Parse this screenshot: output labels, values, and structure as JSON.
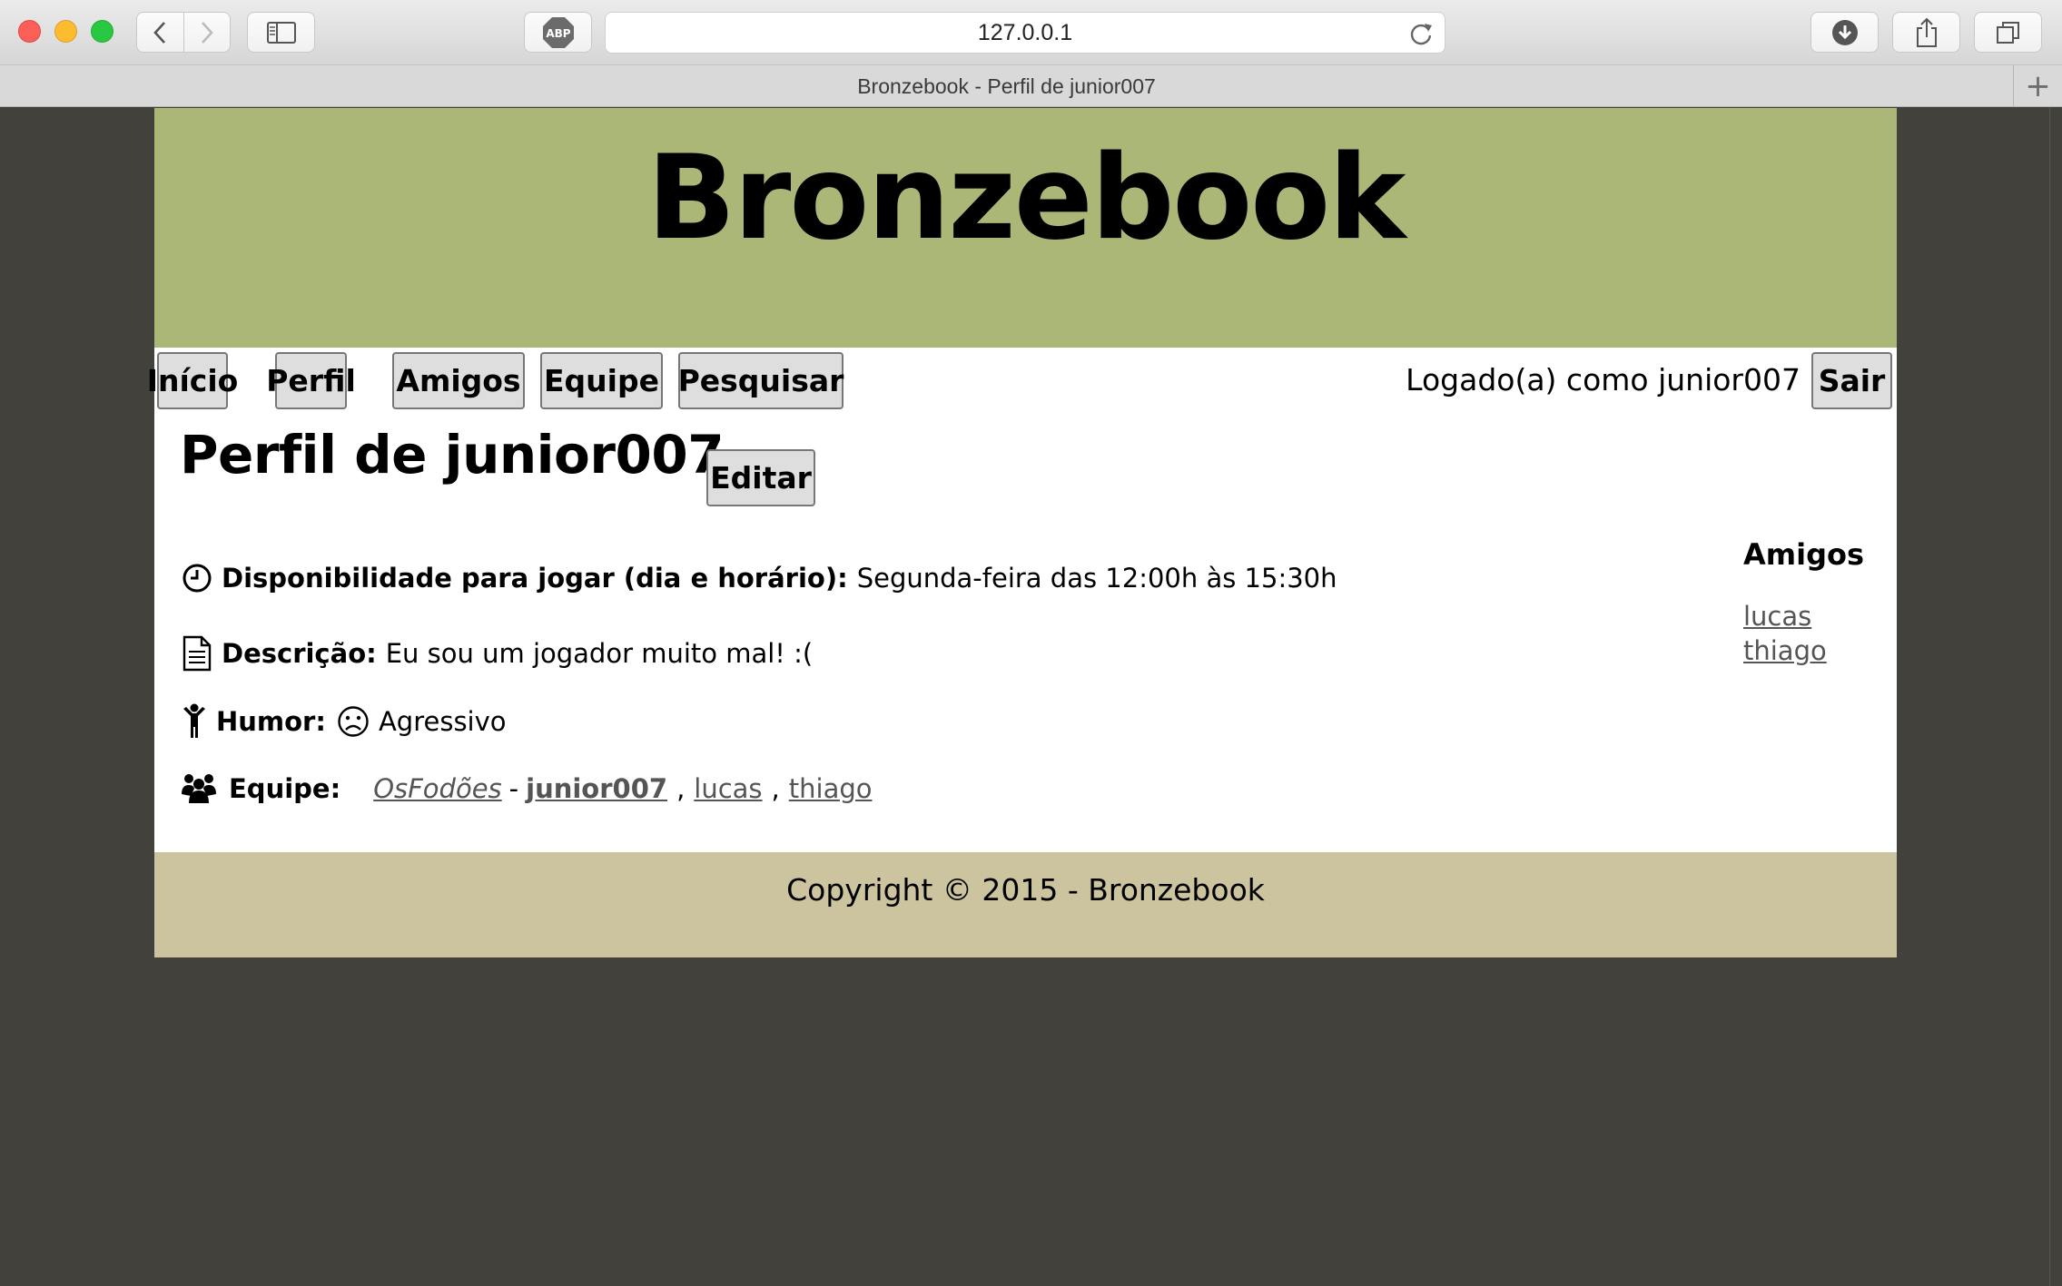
{
  "browser": {
    "url": "127.0.0.1",
    "tab_title": "Bronzebook - Perfil de junior007",
    "adblock_label": "ABP",
    "new_tab_label": "+"
  },
  "site": {
    "title": "Bronzebook"
  },
  "menu": {
    "items": [
      "Início",
      "Perfil",
      "Amigos",
      "Equipe",
      "Pesquisar"
    ],
    "logged_text": "Logado(a) como junior007",
    "logout_label": "Sair"
  },
  "profile": {
    "title": "Perfil de junior007",
    "edit_label": "Editar",
    "availability_label": "Disponibilidade para jogar (dia e horário):",
    "availability_value": "Segunda-feira das 12:00h às 15:30h",
    "description_label": "Descrição:",
    "description_value": "Eu sou um jogador muito mal! :(",
    "mood_label": "Humor:",
    "mood_icon": "frown-face-icon",
    "mood_value": "Agressivo",
    "team_label": "Equipe:",
    "team_name": "OsFodões",
    "team_dash": "-",
    "team_members": [
      "junior007",
      "lucas",
      "thiago"
    ],
    "team_sep": ","
  },
  "friends": {
    "title": "Amigos",
    "items": [
      "lucas",
      "thiago"
    ]
  },
  "footer": {
    "copyright": "Copyright © 2015 - Bronzebook"
  }
}
